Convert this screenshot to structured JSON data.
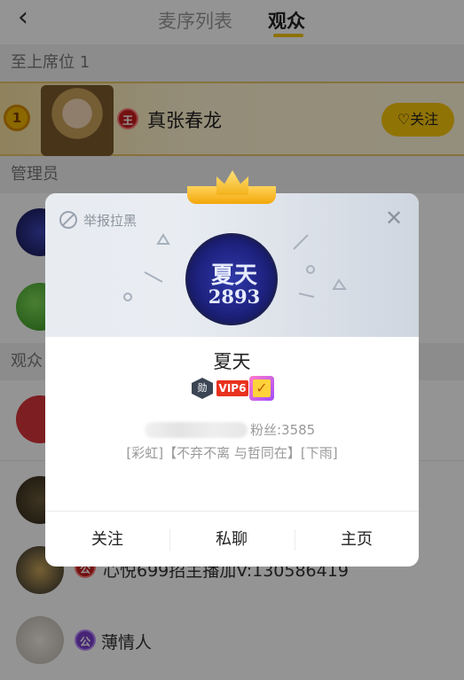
{
  "header": {
    "tabs": [
      {
        "label": "麦序列表",
        "active": false
      },
      {
        "label": "观众",
        "active": true
      }
    ],
    "back_icon": "‹"
  },
  "sections": {
    "seat": "至上席位 1",
    "admins": "管理员",
    "audience": "观众"
  },
  "seat_row": {
    "rank": "1",
    "level_badge": "王",
    "name": "真张春龙",
    "follow_label": "关注"
  },
  "audience_rows": [
    {
      "badge": "公",
      "text": "心悦699招主播加V:130586419"
    },
    {
      "badge": "公",
      "text": "薄情人"
    }
  ],
  "modal": {
    "report_label": "举报拉黑",
    "close_icon": "✕",
    "avatar_text": [
      "夏天",
      "2893"
    ],
    "name": "夏天",
    "badges": {
      "medal": "勋",
      "vip": "VIP6",
      "check": "✓"
    },
    "fans_label": "粉丝:3585",
    "signature": "[彩虹]【不弃不离 与哲同在】[下雨]",
    "actions": [
      {
        "label": "关注"
      },
      {
        "label": "私聊"
      },
      {
        "label": "主页"
      }
    ]
  },
  "colors": {
    "accent": "#f8c70a",
    "vip": "#e8321e",
    "dim_overlay": "rgba(0,0,0,0.42)"
  }
}
